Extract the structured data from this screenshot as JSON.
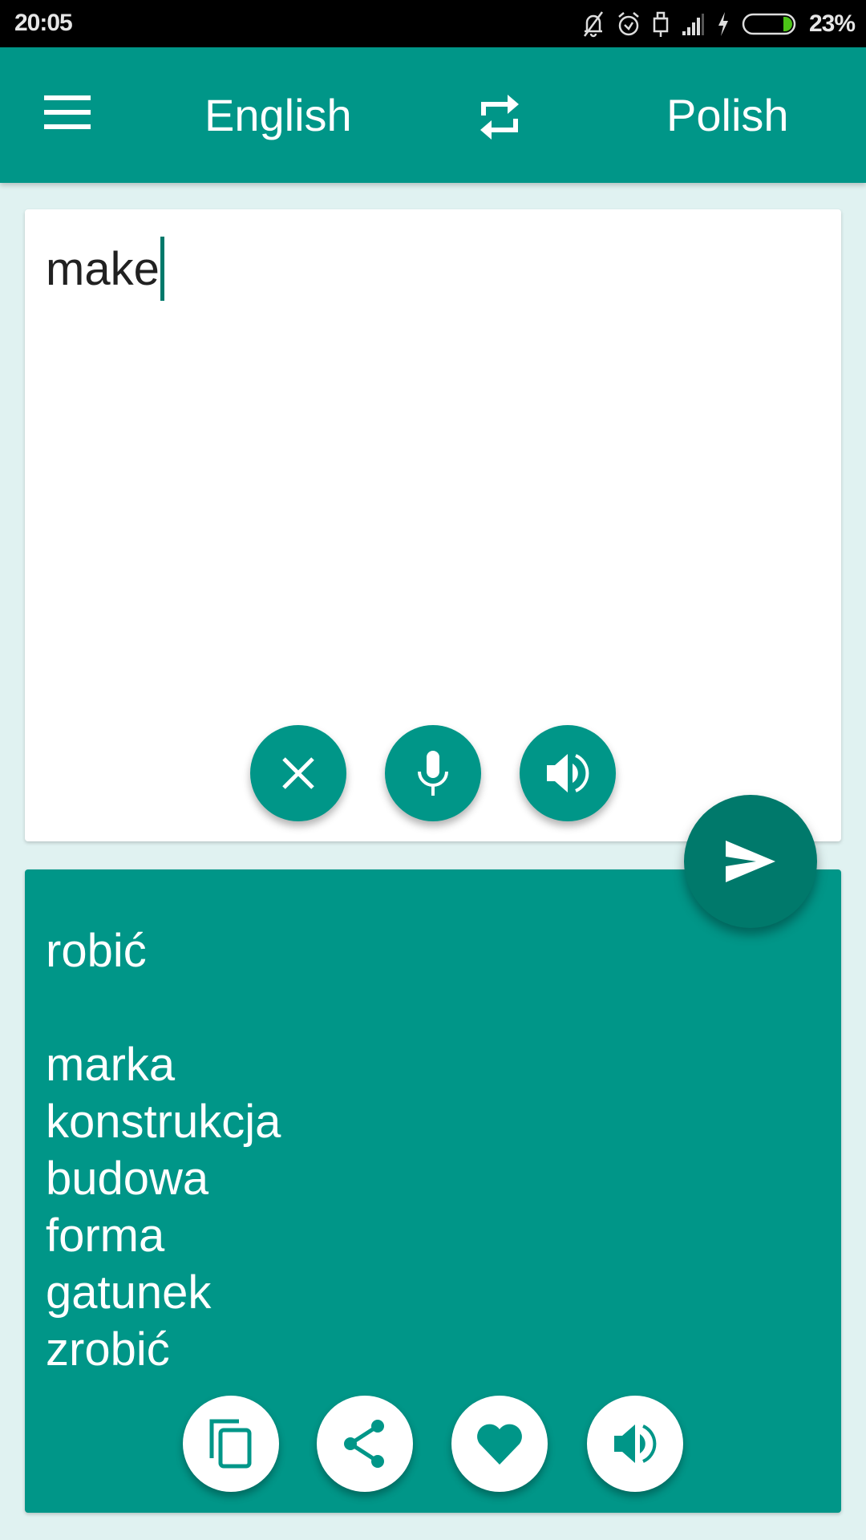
{
  "status_bar": {
    "time": "20:05",
    "icons": [
      "notifications-off-icon",
      "alarm-icon",
      "usb-icon",
      "signal-icon",
      "charging-icon",
      "battery-icon"
    ],
    "battery_percent": "23%",
    "battery_level": 0.23,
    "battery_color": "#4cc417"
  },
  "app_bar": {
    "menu_icon": "hamburger-menu-icon",
    "source_language": "English",
    "swap_icon": "swap-languages-icon",
    "target_language": "Polish",
    "color": "#009688"
  },
  "input_card": {
    "text": "make",
    "buttons": [
      {
        "name": "clear",
        "icon": "close-icon"
      },
      {
        "name": "voice-input",
        "icon": "microphone-icon"
      },
      {
        "name": "speak-input",
        "icon": "speaker-icon"
      }
    ]
  },
  "translate_button": {
    "icon": "send-icon",
    "color": "#00796b"
  },
  "output_card": {
    "primary": "robić",
    "alternatives": [
      "marka",
      "konstrukcja",
      "budowa",
      "forma",
      "gatunek",
      "zrobić"
    ],
    "buttons": [
      {
        "name": "copy",
        "icon": "copy-icon"
      },
      {
        "name": "share",
        "icon": "share-icon"
      },
      {
        "name": "favorite",
        "icon": "heart-icon"
      },
      {
        "name": "speak-output",
        "icon": "speaker-icon"
      }
    ]
  }
}
